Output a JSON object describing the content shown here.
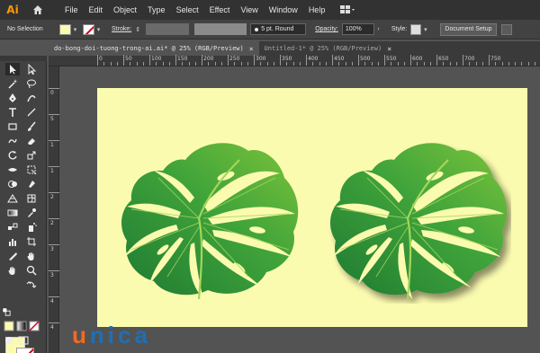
{
  "app": {
    "logo": "Ai"
  },
  "menubar": {
    "items": [
      "File",
      "Edit",
      "Object",
      "Type",
      "Select",
      "Effect",
      "View",
      "Window",
      "Help"
    ]
  },
  "controlbar": {
    "selection_status": "No Selection",
    "stroke_label": "Stroke:",
    "brush_label": "5 pt. Round",
    "opacity_label": "Opacity:",
    "opacity_value": "100%",
    "style_label": "Style:",
    "document_setup": "Document Setup",
    "fill_color": "#fbfbb0",
    "stroke_color": "#d0021b"
  },
  "tabs": [
    {
      "label": "do-bong-doi-tuong-trong-ai.ai* @ 25% (RGB/Preview)",
      "close": "×",
      "active": true
    },
    {
      "label": "Untitled-1* @ 25% (RGB/Preview)",
      "close": "×",
      "active": false
    }
  ],
  "ruler": {
    "top_labels": [
      "0",
      "50",
      "100",
      "150",
      "200",
      "250",
      "300",
      "350",
      "400",
      "450",
      "500",
      "550",
      "600",
      "650",
      "700",
      "750"
    ],
    "left_labels": [
      "0",
      "5",
      "1",
      "1",
      "2",
      "2",
      "3",
      "3",
      "4",
      "4",
      "5"
    ]
  },
  "artboard": {
    "background": "#fbfbb0",
    "leaf_color_dark": "#1f7a32",
    "leaf_color_light": "#7cc43a"
  },
  "watermark": {
    "first": "u",
    "rest": "nica"
  }
}
